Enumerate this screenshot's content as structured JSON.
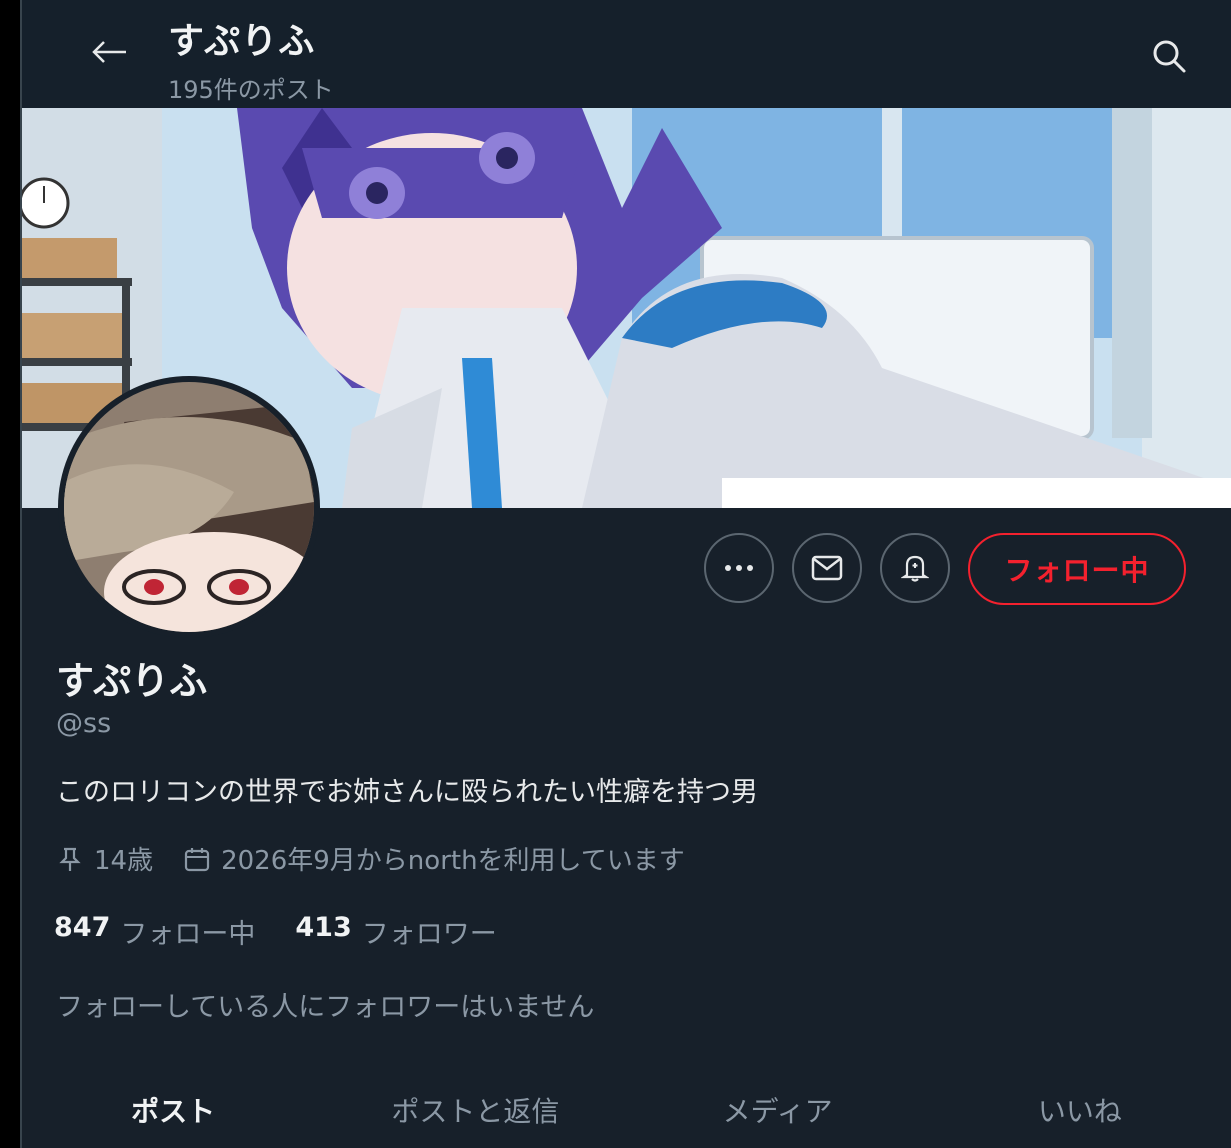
{
  "header": {
    "title": "すぷりふ",
    "post_count": "195件のポスト"
  },
  "icons": {
    "back": "arrow-left-icon",
    "search": "search-icon",
    "more": "more-icon",
    "message": "mail-icon",
    "notify": "bell-icon",
    "pin": "pin-icon",
    "calendar": "calendar-icon"
  },
  "actions": {
    "follow_label": "フォロー中"
  },
  "profile": {
    "name": "すぷりふ",
    "handle": "@ss",
    "bio": "このロリコンの世界でお姉さんに殴られたい性癖を持つ男",
    "age": "14歳",
    "joined": "2026年9月からnorthを利用しています",
    "following_count": "847",
    "following_label": "フォロー中",
    "followers_count": "413",
    "followers_label": "フォロワー",
    "mutual_note": "フォローしている人にフォロワーはいません"
  },
  "tabs": [
    {
      "label": "ポスト"
    },
    {
      "label": "ポストと返信"
    },
    {
      "label": "メディア"
    },
    {
      "label": "いいね"
    }
  ],
  "colors": {
    "background": "#17202a",
    "accent_red": "#f4212e",
    "muted": "#8b98a5"
  }
}
